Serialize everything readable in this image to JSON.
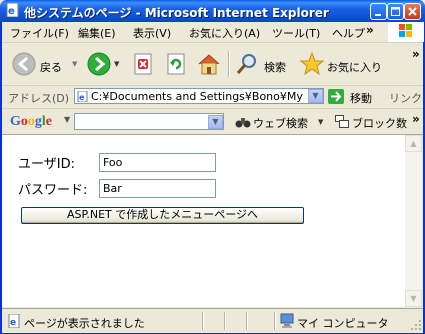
{
  "window": {
    "title": "他システムのページ - Microsoft Internet Explorer",
    "min_icon": "minimize-icon",
    "max_icon": "maximize-icon",
    "close_icon": "close-icon"
  },
  "menu": {
    "items": [
      "ファイル(F)",
      "編集(E)",
      "表示(V)",
      "お気に入り(A)",
      "ツール(T)",
      "ヘルプ"
    ],
    "overflow": "»"
  },
  "toolbar": {
    "back_label": "戻る",
    "search_label": "検索",
    "favorites_label": "お気に入り",
    "overflow": "»"
  },
  "address": {
    "label": "アドレス(D)",
    "url": "C:¥Documents and Settings¥Bono¥My Doc",
    "go_label": "移動",
    "links_label": "リンク"
  },
  "google_bar": {
    "logo": "Google",
    "web_search_label": "ウェブ検索",
    "block_count_label": "ブロック数",
    "overflow": "»"
  },
  "form": {
    "userid_label": "ユーザID:",
    "userid_value": "Foo",
    "password_label": "パスワード:",
    "password_value": "Bar",
    "submit_label": "ASP.NET で作成したメニューページへ"
  },
  "status": {
    "text": "ページが表示されました",
    "zone": "マイ コンピュータ"
  },
  "colors": {
    "titlebar": "#0a5ee6",
    "window_bg": "#ece9d8",
    "input_border": "#7f9db9"
  }
}
